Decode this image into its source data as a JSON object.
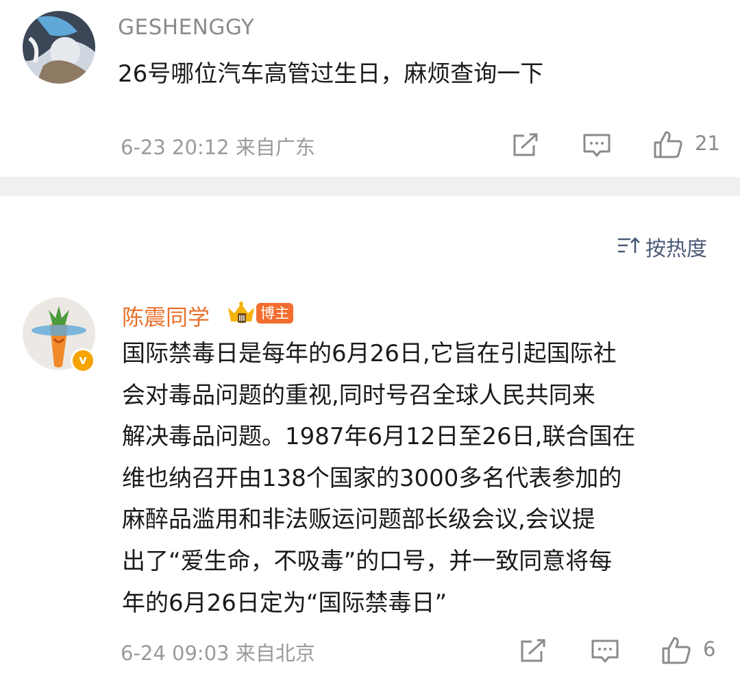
{
  "comment1": {
    "username": "GESHENGGY",
    "text": "26号哪位汽车高管过生日，麻烦查询一下",
    "meta": "6-23 20:12 来自广东",
    "likes": "21"
  },
  "sort": {
    "label": "按热度",
    "icon": "sort-icon"
  },
  "comment2": {
    "username": "陈震同学",
    "badge": "博主",
    "verified": "v",
    "text": "国际禁毒日是每年的6月26日,它旨在引起国际社\n会对毒品问题的重视,同时号召全球人民共同来\n解决毒品问题。1987年6月12日至26日,联合国在\n维也纳召开由138个国家的3000多名代表参加的\n麻醉品滥用和非法贩运问题部长级会议,会议提\n出了“爱生命，不吸毒”的口号，并一致同意将每\n年的6月26日定为“国际禁毒日”",
    "meta": "6-24 09:03 来自北京",
    "likes": "6"
  },
  "colors": {
    "accent_name": "#e8702a",
    "badge_bg": "#f36d2e",
    "verified": "#f6a400",
    "sort_text": "#4a5a78"
  },
  "icons": [
    "share-icon",
    "comment-icon",
    "like-icon",
    "crown-icon"
  ]
}
